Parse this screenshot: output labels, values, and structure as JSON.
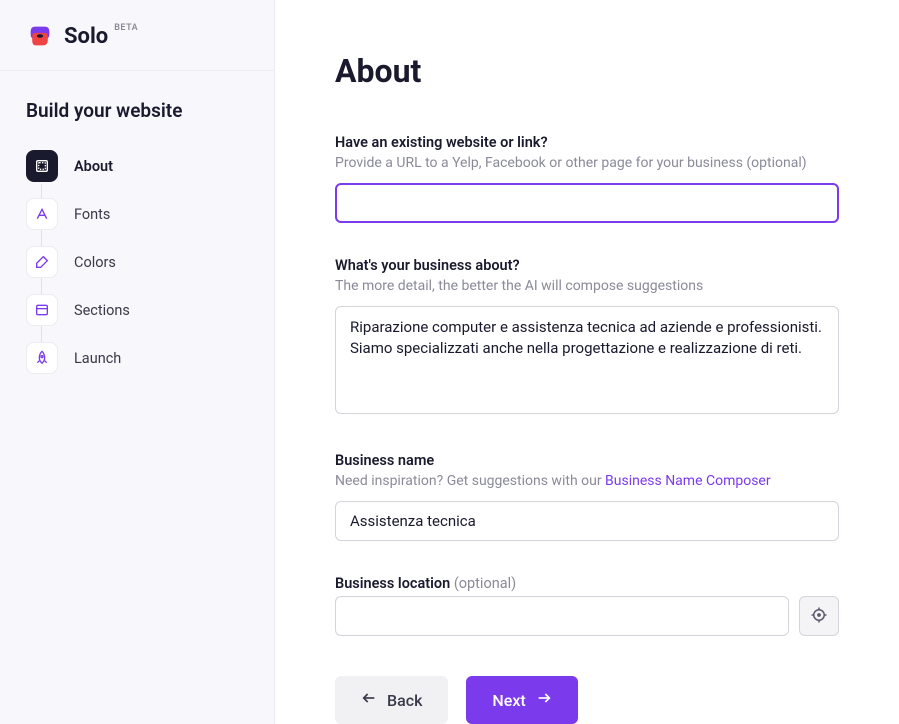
{
  "brand": {
    "name": "Solo",
    "badge": "BETA"
  },
  "sidebar": {
    "heading": "Build your website",
    "items": [
      {
        "label": "About",
        "active": true
      },
      {
        "label": "Fonts",
        "active": false
      },
      {
        "label": "Colors",
        "active": false
      },
      {
        "label": "Sections",
        "active": false
      },
      {
        "label": "Launch",
        "active": false
      }
    ]
  },
  "page": {
    "title": "About",
    "fields": {
      "existing_link": {
        "label": "Have an existing website or link?",
        "help": "Provide a URL to a Yelp, Facebook or other page for your business (optional)",
        "value": ""
      },
      "about": {
        "label": "What's your business about?",
        "help": "The more detail, the better the AI will compose suggestions",
        "value": "Riparazione computer e assistenza tecnica ad aziende e professionisti. Siamo specializzati anche nella progettazione e realizzazione di reti."
      },
      "business_name": {
        "label": "Business name",
        "help_prefix": "Need inspiration? Get suggestions with our ",
        "help_link": "Business Name Composer",
        "value": "Assistenza tecnica"
      },
      "location": {
        "label": "Business location",
        "optional": "(optional)",
        "value": ""
      }
    },
    "buttons": {
      "back": "Back",
      "next": "Next"
    }
  }
}
